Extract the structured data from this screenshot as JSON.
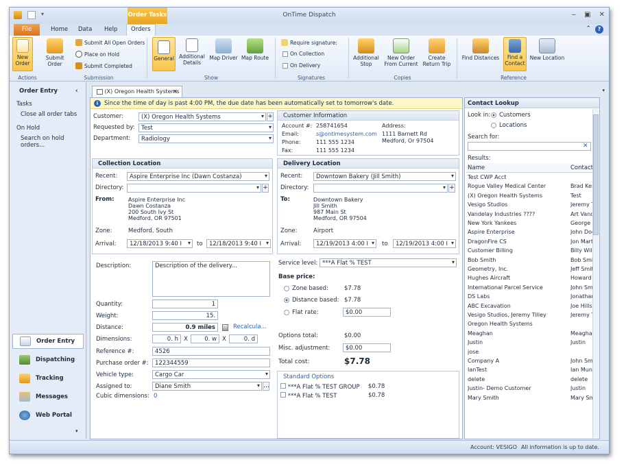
{
  "window": {
    "title": "OnTime Dispatch",
    "context_tab": "Order Tasks"
  },
  "ribbon_tabs": [
    "File",
    "Home",
    "Data",
    "Help",
    "Orders"
  ],
  "ribbon": {
    "new_order": "New\nOrder",
    "submit_order": "Submit\nOrder",
    "submit_all": "Submit All Open Orders",
    "place_on_hold": "Place on Hold",
    "submit_completed": "Submit Completed",
    "general": "General",
    "additional_details": "Additional\nDetails",
    "map_driver": "Map Driver",
    "map_route": "Map Route",
    "require_signature": "Require signature:",
    "on_collection": "On Collection",
    "on_delivery": "On Delivery",
    "additional_stop": "Additional\nStop",
    "new_order_from_current": "New Order\nFrom Current",
    "create_return_trip": "Create\nReturn Trip",
    "find_distances": "Find Distances",
    "find_a_contact": "Find a\nContact",
    "new_location": "New Location",
    "groups": {
      "actions": "Actions",
      "submission": "Submission",
      "show": "Show",
      "signatures": "Signatures",
      "copies": "Copies",
      "reference": "Reference"
    }
  },
  "left_panel": {
    "title": "Order Entry",
    "tasks_label": "Tasks",
    "tasks": [
      "Close all order tabs"
    ],
    "on_hold_label": "On Hold",
    "on_hold": [
      "Search on hold\norders..."
    ],
    "nav": [
      "Order Entry",
      "Dispatching",
      "Tracking",
      "Messages",
      "Web Portal"
    ]
  },
  "doc_tab": "(X) Oregon Health Systems",
  "notice": "Since the time of day is past 4:00 PM, the due date has been automatically set to tomorrow's date.",
  "order": {
    "customer_label": "Customer:",
    "customer": "(X) Oregon Health Systems",
    "requested_label": "Requested by:",
    "requested": "Test",
    "department_label": "Department:",
    "department": "Radiology"
  },
  "customer_info": {
    "title": "Customer Information",
    "account_label": "Account #:",
    "account": "258741654",
    "email_label": "Email:",
    "email": "s@ontimesystem.com",
    "phone_label": "Phone:",
    "phone": "111 555 1234",
    "fax_label": "Fax:",
    "fax": "111 555 1234",
    "address_label": "Address:",
    "address1": "1111 Barnett Rd",
    "address2": "Medford, Or  97504"
  },
  "collection": {
    "title": "Collection Location",
    "recent_label": "Recent:",
    "recent": "Aspire Enterprise Inc (Dawn Costanza)",
    "directory_label": "Directory:",
    "from_label": "From:",
    "lines": [
      "Aspire Enterprise Inc",
      "Dawn Costanza",
      "200 South Ivy St",
      "Medford, OR  97501"
    ],
    "zone_label": "Zone:",
    "zone": "Medford, South",
    "arrival_label": "Arrival:",
    "arrival_from": "12/18/2013 9:40 I",
    "to_label": "to",
    "arrival_to": "12/18/2013 9:40 I"
  },
  "delivery": {
    "title": "Delivery Location",
    "recent_label": "Recent:",
    "recent": "Downtown Bakery (Jill Smith)",
    "directory_label": "Directory:",
    "to_label_addr": "To:",
    "lines": [
      "Downtown Bakery",
      "Jill Smith",
      "987 Main St",
      "Medford, OR  97504"
    ],
    "zone_label": "Zone:",
    "zone": "Airport",
    "arrival_label": "Arrival:",
    "arrival_from": "12/19/2013 4:00 I",
    "to_label": "to",
    "arrival_to": "12/19/2013 4:00 I"
  },
  "details": {
    "description_label": "Description:",
    "description": "Description of the delivery...",
    "quantity_label": "Quantity:",
    "quantity": "1",
    "weight_label": "Weight:",
    "weight": "15.",
    "distance_label": "Distance:",
    "distance": "0.9 miles",
    "recalc": "Recalcula...",
    "dimensions_label": "Dimensions:",
    "dim_h": "0. h",
    "dim_w": "0. w",
    "dim_d": "0. d",
    "x": "X",
    "reference_label": "Reference #:",
    "reference": "4526",
    "po_label": "Purchase order #:",
    "po": "122344559",
    "vehicle_label": "Vehicle type:",
    "vehicle": "Cargo Car",
    "assigned_label": "Assigned to:",
    "assigned": "Diane Smith",
    "cubic_label": "Cubic dimensions:",
    "cubic": "0"
  },
  "pricing": {
    "service_label": "Service level:",
    "service": "***A Flat % TEST",
    "base_price_label": "Base price:",
    "zone_based_label": "Zone based:",
    "zone_based": "$7.78",
    "distance_based_label": "Distance based:",
    "distance_based": "$7.78",
    "flat_rate_label": "Flat rate:",
    "flat_rate": "$0.00",
    "options_total_label": "Options total:",
    "options_total": "$0.00",
    "misc_label": "Misc. adjustment:",
    "misc": "$0.00",
    "total_label": "Total cost:",
    "total": "$7.78",
    "standard_options_label": "Standard Options",
    "options": [
      {
        "name": "***A Flat % TEST GROUP",
        "price": "$0.78"
      },
      {
        "name": "***A Flat % TEST",
        "price": "$0.78"
      }
    ]
  },
  "contact_lookup": {
    "title": "Contact Lookup",
    "look_in_label": "Look in:",
    "customers": "Customers",
    "locations": "Locations",
    "search_label": "Search for:",
    "results_label": "Results:",
    "col_name": "Name",
    "col_contact": "Contact",
    "rows": [
      [
        "Test CWP Acct",
        ""
      ],
      [
        "Rogue Valley Medical Center",
        "Brad Ker"
      ],
      [
        "(X) Oregon Health Systems",
        "Test"
      ],
      [
        "Vesigo Studios",
        "Jeremy T"
      ],
      [
        "Vandelay Industries ????",
        "Art Vand"
      ],
      [
        "New York Yankees",
        "George S"
      ],
      [
        "Aspire Enterprise",
        "John Doe"
      ],
      [
        "DragonFire CS",
        "Jon Mart"
      ],
      [
        "Customer Billing",
        "Billy Willi"
      ],
      [
        "Bob Smith",
        "Bob Smit"
      ],
      [
        "Geometry, Inc.",
        "Jeff Smit"
      ],
      [
        "Hughes Aircraft",
        "Howard I"
      ],
      [
        "International Parcel Service",
        "John Smi"
      ],
      [
        "DS Labs",
        "Jonathar"
      ],
      [
        "ABC Excavation",
        "Joe Hills"
      ],
      [
        "Vesigo Studios, Jeremy Tilley",
        "Jeremy T"
      ],
      [
        "Oregon Health Systems",
        ""
      ],
      [
        "Meaghan",
        "Meaghar"
      ],
      [
        "Justin",
        "Justin"
      ],
      [
        "jose",
        ""
      ],
      [
        "Company A",
        "John Smi"
      ],
      [
        "IanTest",
        "Ian Munr"
      ],
      [
        "delete",
        "delete"
      ],
      [
        "Justin- Demo Customer",
        "Justin"
      ],
      [
        "Mary Smith",
        "Mary Sm"
      ]
    ]
  },
  "status": {
    "account": "Account: VESIGO",
    "message": "All information is up to date."
  },
  "colors": {
    "accent": "#f8c64f",
    "file_tab": "#d8721c",
    "link": "#2a63b3"
  }
}
